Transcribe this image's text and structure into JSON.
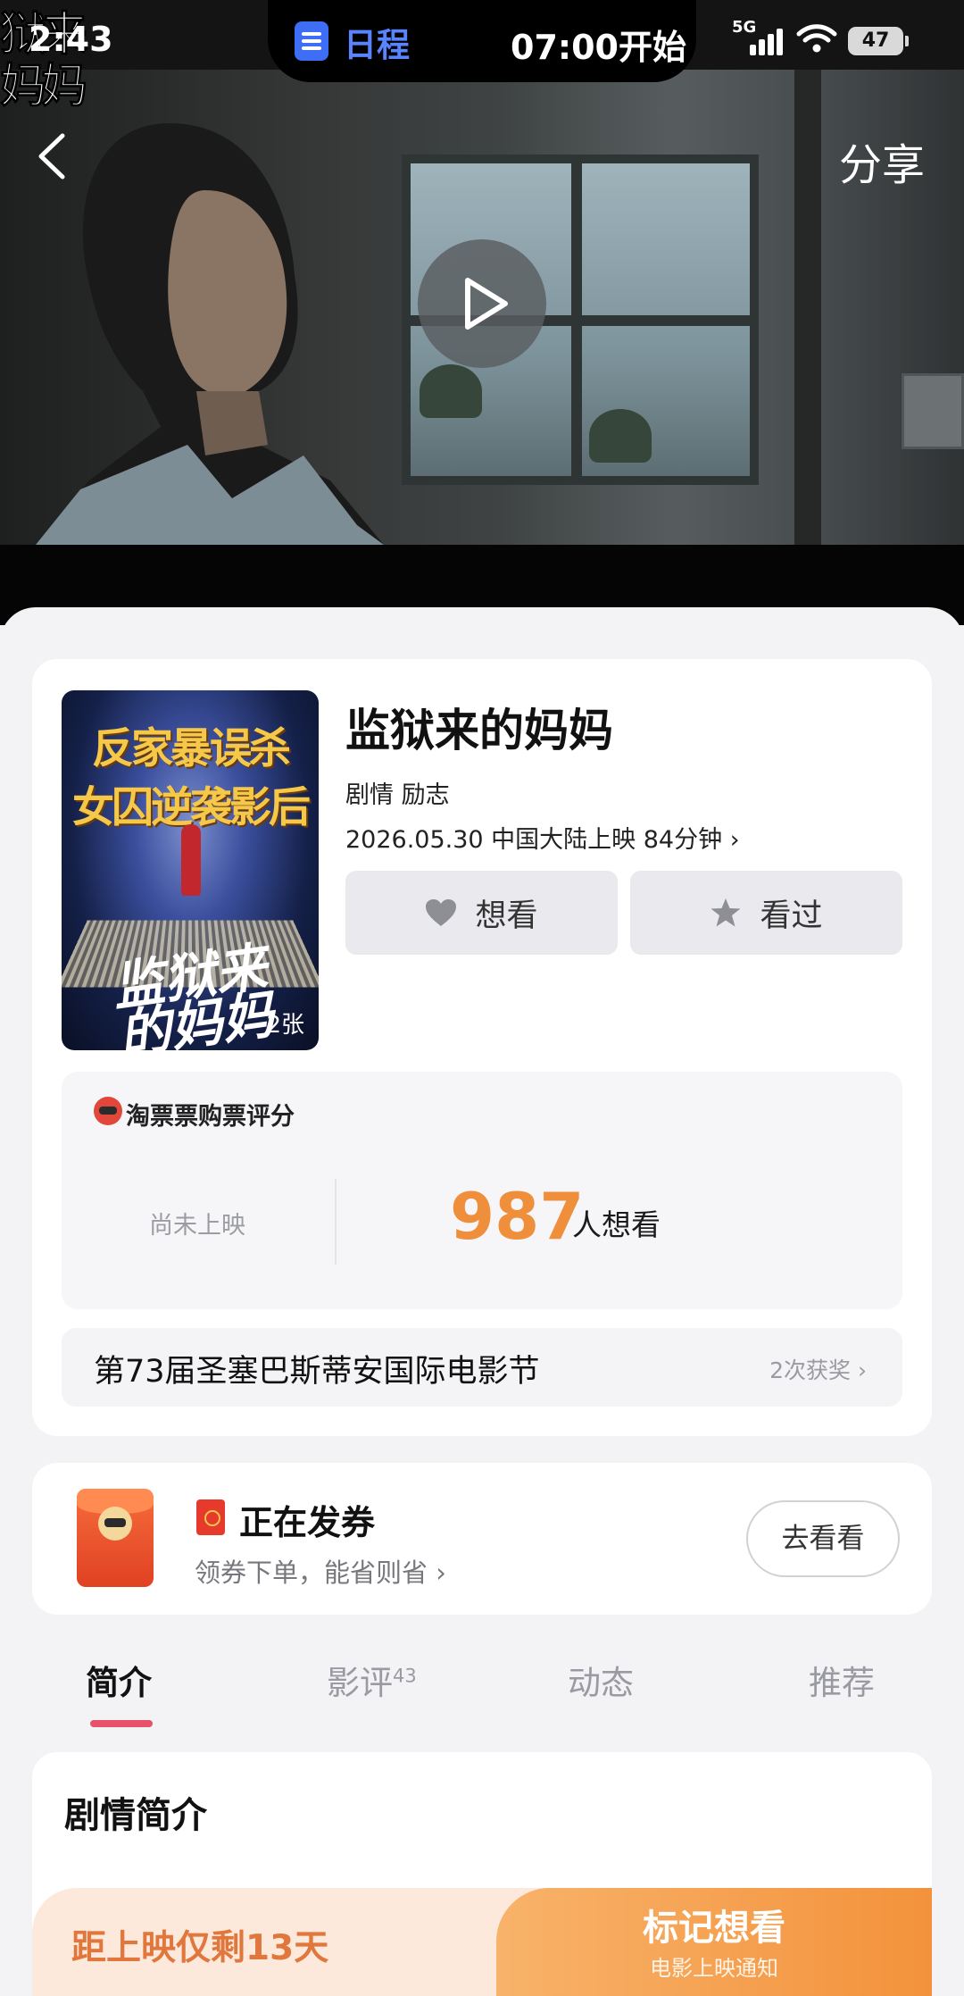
{
  "status_bar": {
    "time": "2:43",
    "island_app": "日程",
    "island_event": "07:00开始",
    "network": "5G",
    "battery": "47"
  },
  "video": {
    "share_label": "分享",
    "watermark": "狱来妈妈"
  },
  "movie": {
    "title": "监狱来的妈妈",
    "genres": "剧情 励志",
    "release_info": "2026.05.30 中国大陆上映 84分钟",
    "poster": {
      "line1": "反家暴误杀",
      "line2": "女囚逆袭影后",
      "calligraphy": "监狱来的妈妈",
      "image_count": "2张"
    }
  },
  "actions": {
    "want_label": "想看",
    "watched_label": "看过"
  },
  "rating": {
    "title": "淘票票购票评分",
    "status": "尚未上映",
    "want_count": "987",
    "want_unit": "人想看"
  },
  "award": {
    "festival": "第73届圣塞巴斯蒂安国际电影节",
    "wins": "2次获奖"
  },
  "coupon": {
    "title": "正在发券",
    "subtitle": "领券下单，能省则省",
    "button_label": "去看看"
  },
  "tabs": [
    {
      "label": "简介",
      "badge": ""
    },
    {
      "label": "影评",
      "badge": "43"
    },
    {
      "label": "动态",
      "badge": ""
    },
    {
      "label": "推荐",
      "badge": ""
    }
  ],
  "synopsis": {
    "title": "剧情简介"
  },
  "bottom": {
    "countdown": "距上映仅剩13天",
    "mark_label": "标记想看",
    "mark_sub": "电影上映通知"
  },
  "colors": {
    "accent_orange": "#ef8e3b",
    "tab_indicator": "#e8516a",
    "cta_gradient_start": "#f8b36a",
    "cta_gradient_end": "#f3923c"
  }
}
